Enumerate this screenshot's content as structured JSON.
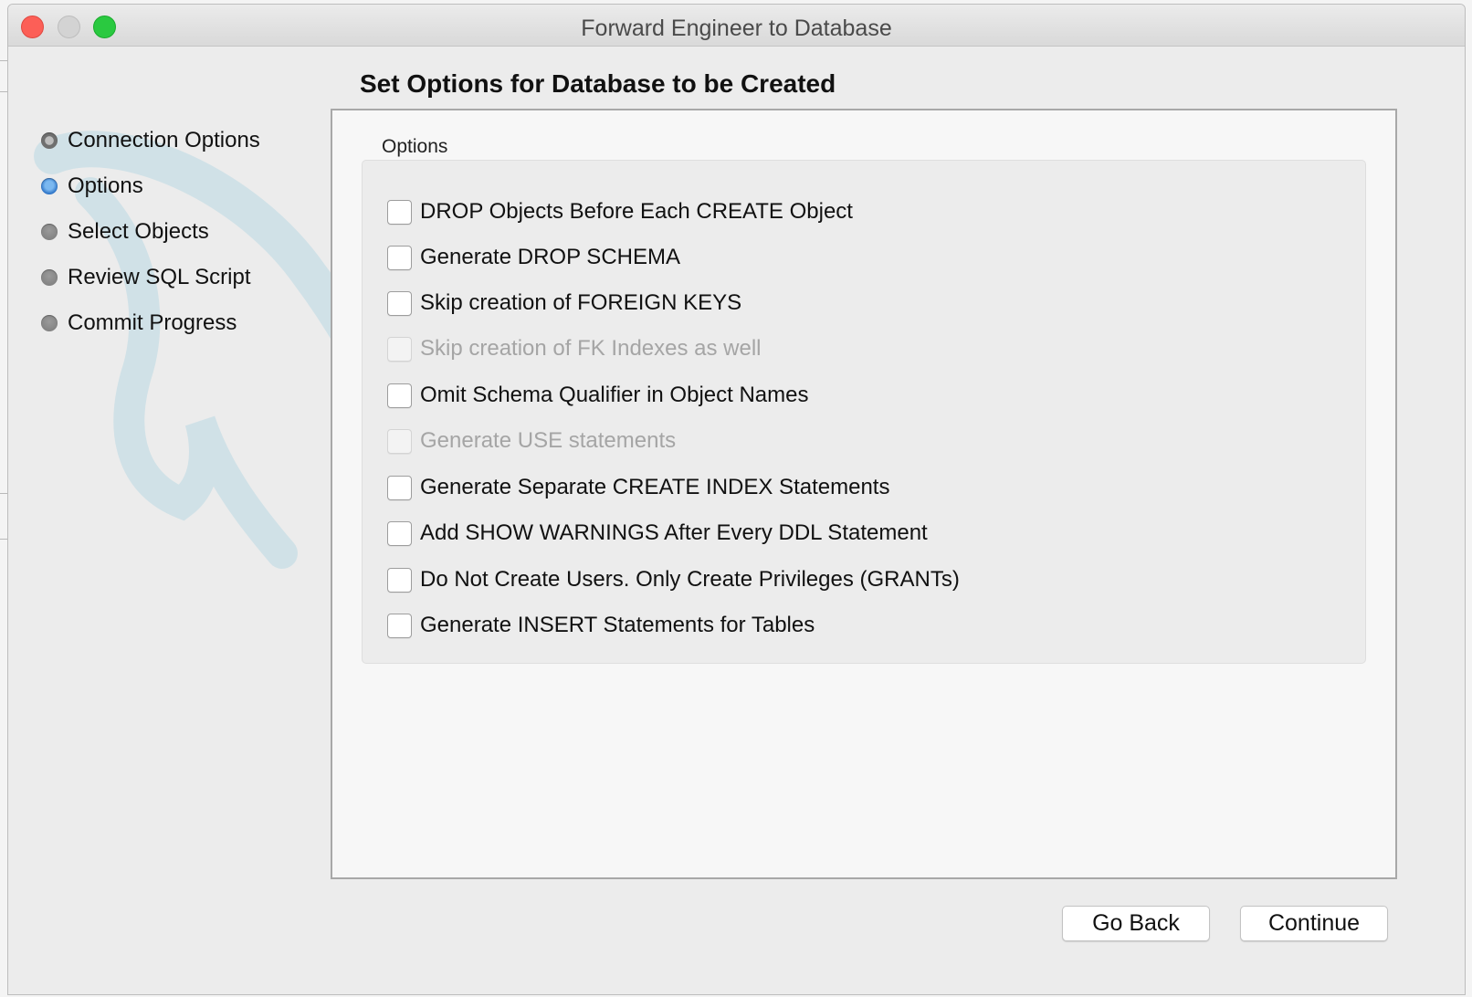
{
  "window": {
    "title": "Forward Engineer to Database"
  },
  "steps": [
    {
      "label": "Connection Options",
      "state": "done"
    },
    {
      "label": "Options",
      "state": "active"
    },
    {
      "label": "Select Objects",
      "state": "pending"
    },
    {
      "label": "Review SQL Script",
      "state": "pending"
    },
    {
      "label": "Commit Progress",
      "state": "pending"
    }
  ],
  "main": {
    "heading": "Set Options for Database to be Created",
    "group_label": "Options",
    "options": [
      {
        "label": "DROP Objects Before Each CREATE Object",
        "checked": false,
        "enabled": true
      },
      {
        "label": "Generate DROP SCHEMA",
        "checked": false,
        "enabled": true
      },
      {
        "label": "Skip creation of FOREIGN KEYS",
        "checked": false,
        "enabled": true
      },
      {
        "label": "Skip creation of FK Indexes as well",
        "checked": false,
        "enabled": false
      },
      {
        "label": "Omit Schema Qualifier in Object Names",
        "checked": false,
        "enabled": true
      },
      {
        "label": "Generate USE statements",
        "checked": false,
        "enabled": false
      },
      {
        "label": "Generate Separate CREATE INDEX Statements",
        "checked": false,
        "enabled": true
      },
      {
        "label": "Add SHOW WARNINGS After Every DDL Statement",
        "checked": false,
        "enabled": true
      },
      {
        "label": "Do Not Create Users. Only Create Privileges (GRANTs)",
        "checked": false,
        "enabled": true
      },
      {
        "label": "Generate INSERT Statements for Tables",
        "checked": false,
        "enabled": true
      }
    ]
  },
  "footer": {
    "back_label": "Go Back",
    "continue_label": "Continue"
  },
  "colors": {
    "accent": "#2b72c6",
    "close": "#fc5f57",
    "zoom": "#2ac940"
  }
}
